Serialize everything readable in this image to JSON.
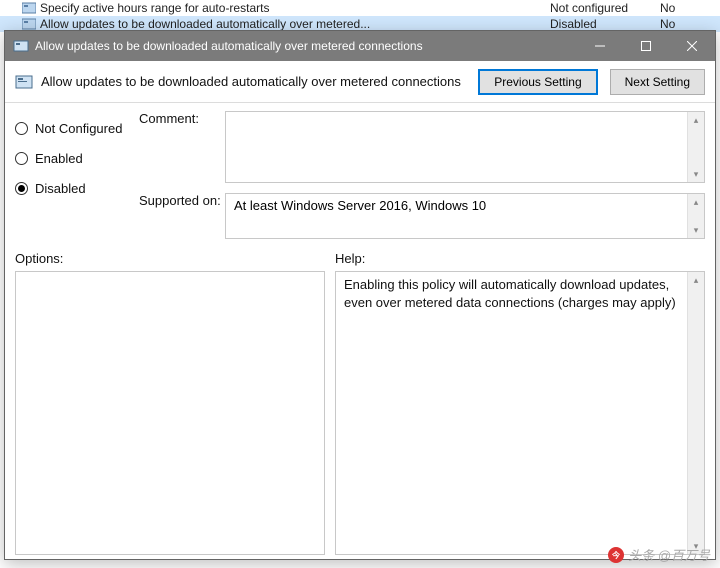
{
  "bg_rows": [
    {
      "name": "Specify active hours range for auto-restarts",
      "state": "Not configured",
      "c3": "No",
      "sel": false
    },
    {
      "name": "Allow updates to be downloaded automatically over metered...",
      "state": "Disabled",
      "c3": "No",
      "sel": true
    }
  ],
  "window": {
    "title": "Allow updates to be downloaded automatically over metered connections",
    "header": "Allow updates to be downloaded automatically over metered connections",
    "prev": "Previous Setting",
    "next": "Next Setting"
  },
  "radios": {
    "not_configured": "Not Configured",
    "enabled": "Enabled",
    "disabled": "Disabled",
    "selected": "disabled"
  },
  "labels": {
    "comment": "Comment:",
    "supported": "Supported on:",
    "options": "Options:",
    "help": "Help:"
  },
  "supported_text": "At least Windows Server 2016, Windows 10",
  "help_text": "Enabling this policy will automatically download updates, even over metered data connections (charges may apply)",
  "watermark": "头条 @百万号"
}
